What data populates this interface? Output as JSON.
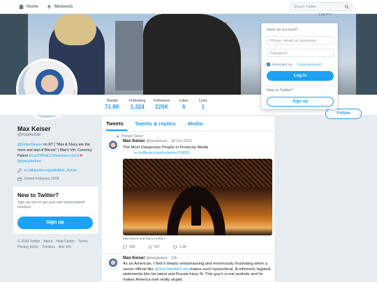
{
  "nav": {
    "home": "Home",
    "moments": "Moments",
    "search_placeholder": "Search Twitter",
    "login_link": "Log in ▾"
  },
  "profile": {
    "name": "Max Keiser",
    "handle": "@maxkeiser",
    "bio_line1_link": "@KeiserReport",
    "bio_line1_text": " on RT | \"Max & Stacy are the mom and dad of Bitcoin\" | Max's Virt. Currency Patent",
    "bio_link2": "bit.ly/OA5aiL9",
    "bio_link3": "Maxkeiser.com",
    "bio_sep": " | ",
    "bio_link4": "@stacyherbert",
    "website": "en.wikipedia.org/wiki/Max_Keiser",
    "joined": "Joined February 2009"
  },
  "stats": [
    {
      "label": "Tweets",
      "value": "71.8K"
    },
    {
      "label": "Following",
      "value": "1,324"
    },
    {
      "label": "Followers",
      "value": "220K"
    },
    {
      "label": "Likes",
      "value": "6"
    },
    {
      "label": "Lists",
      "value": "1"
    }
  ],
  "follow_label": "Follow",
  "new_to_twitter": {
    "title": "New to Twitter?",
    "text": "Sign up now to get your own personalized timeline!",
    "button": "Sign up"
  },
  "footer": {
    "row1": [
      "© 2019 Twitter",
      "About",
      "Help Center",
      "Terms"
    ],
    "row2": [
      "Privacy policy",
      "Cookies",
      "Ads info"
    ]
  },
  "tabs": [
    "Tweets",
    "Tweets & replies",
    "Media"
  ],
  "tweets": [
    {
      "pinned_label": "Pinned Tweet",
      "name": "Max Keiser",
      "handle": "@maxkeiser",
      "time": "· 16 Oct 2016",
      "text": "The Most Dangerous People in Financial Media",
      "link": "m.huffpost.com/us/entry/16655",
      "image_caption": "Max Keiser and Stacy Herbert",
      "replies": "",
      "retweets": "355",
      "likes": "627",
      "extra": "1.3K"
    },
    {
      "name": "Max Keiser",
      "handle": "@maxkeiser",
      "time": "· 13h",
      "text_a": "As an American, I find it deeply embarrassing and enormously frustrating when a senior official like ",
      "mention": "@SenJohnMcCain",
      "text_b": " makes such hypocritical, ill-informed, bigoted, statements like his latest anti-Russia hissy fit. This guy's a real asshole and he makes America look really stupid."
    }
  ],
  "login_dropdown": {
    "have_account": "Have an account?",
    "user_placeholder": "Phone, email, or username",
    "password_placeholder": "Password",
    "remember": "Remember me",
    "forgot": "· Forgot password?",
    "login_button": "Log in",
    "new_label": "New to Twitter?",
    "signup_button": "Sign up"
  },
  "colors": {
    "accent": "#1da1f2",
    "background": "#e6ecf0",
    "text": "#14171a",
    "muted": "#657786",
    "like_red": "#e0245e"
  }
}
